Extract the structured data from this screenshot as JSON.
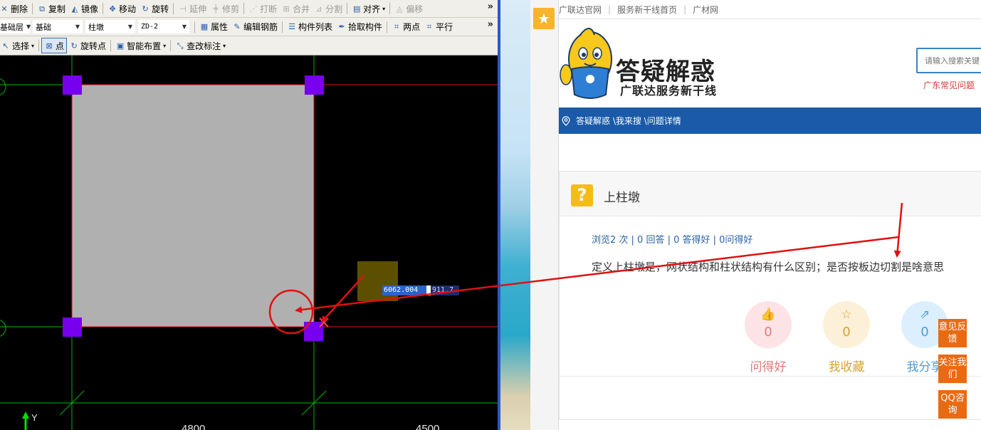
{
  "cad": {
    "toolbar1": [
      {
        "label": "删除",
        "icon": "delete-icon",
        "glyph": "✕",
        "disabled": false
      },
      {
        "label": "复制",
        "icon": "copy-icon",
        "glyph": "⧉",
        "disabled": false
      },
      {
        "label": "镜像",
        "icon": "mirror-icon",
        "glyph": "◭",
        "disabled": false
      },
      {
        "label": "移动",
        "icon": "move-icon",
        "glyph": "✥",
        "disabled": false
      },
      {
        "label": "旋转",
        "icon": "rotate-icon",
        "glyph": "↻",
        "disabled": false
      },
      {
        "label": "延伸",
        "icon": "extend-icon",
        "glyph": "⊣",
        "disabled": true
      },
      {
        "label": "修剪",
        "icon": "trim-icon",
        "glyph": "╪",
        "disabled": true
      },
      {
        "label": "打断",
        "icon": "break-icon",
        "glyph": "⋰",
        "disabled": true
      },
      {
        "label": "合并",
        "icon": "merge-icon",
        "glyph": "⊞",
        "disabled": true
      },
      {
        "label": "分割",
        "icon": "split-icon",
        "glyph": "⊿",
        "disabled": true
      },
      {
        "label": "对齐",
        "icon": "align-icon",
        "glyph": "▤",
        "disabled": false,
        "dropdown": true
      },
      {
        "label": "偏移",
        "icon": "offset-icon",
        "glyph": "◬",
        "disabled": true
      }
    ],
    "layer_combo": "基础层",
    "category_combo": "基础",
    "type_combo": "柱墩",
    "name_combo": "ZD-2",
    "toolbar2": [
      {
        "label": "属性",
        "icon": "properties-icon",
        "glyph": "▦"
      },
      {
        "label": "编辑钢筋",
        "icon": "edit-rebar-icon",
        "glyph": "✎"
      },
      {
        "label": "构件列表",
        "icon": "component-list-icon",
        "glyph": "☰"
      },
      {
        "label": "拾取构件",
        "icon": "pick-component-icon",
        "glyph": "✒"
      },
      {
        "label": "两点",
        "icon": "two-point-icon",
        "glyph": "⌗"
      },
      {
        "label": "平行",
        "icon": "parallel-icon",
        "glyph": "⌗"
      }
    ],
    "toolbar3": [
      {
        "label": "选择",
        "icon": "select-icon",
        "glyph": "↖",
        "dropdown": true,
        "pressed": false
      },
      {
        "label": "点",
        "icon": "point-icon",
        "glyph": "⊠",
        "dropdown": false,
        "pressed": true
      },
      {
        "label": "旋转点",
        "icon": "rotate-point-icon",
        "glyph": "↻",
        "dropdown": false,
        "pressed": false
      },
      {
        "label": "智能布置",
        "icon": "smart-layout-icon",
        "glyph": "▣",
        "dropdown": true,
        "pressed": false
      },
      {
        "label": "查改标注",
        "icon": "annotation-icon",
        "glyph": "⤡",
        "dropdown": true,
        "pressed": false
      }
    ],
    "more_glyph": "»",
    "coord_x": "6062.004",
    "coord_y": "911.7",
    "dim_left": "4800",
    "dim_right": "4500",
    "axis_y_label": "Y"
  },
  "web": {
    "topnav": [
      "广联达官网",
      "服务新干线首页",
      "广材网"
    ],
    "brand_title": "答疑解惑",
    "brand_sub": "广联达服务新干线",
    "search_placeholder": "请输入搜索关键",
    "hot_link": "广东常见问题",
    "breadcrumb": "答疑解惑 \\我来搜 \\问题详情",
    "question_title": "上柱墩",
    "question_mark": "?",
    "stats": "浏览2 次 | 0 回答 | 0 答得好 | 0问得好",
    "question_body": "定义上柱墩是，网状结构和柱状结构有什么区别；是否按板边切割是啥意思",
    "actions": [
      {
        "label": "问得好",
        "count": "0",
        "icon": "thumbs-up-icon",
        "glyph": "👍",
        "fg": "#e07a7a",
        "bg": "#fde3e6"
      },
      {
        "label": "我收藏",
        "count": "0",
        "icon": "star-icon",
        "glyph": "☆",
        "fg": "#d9a23a",
        "bg": "#fdf0d8"
      },
      {
        "label": "我分享",
        "count": "0",
        "icon": "share-icon",
        "glyph": "⇗",
        "fg": "#4a9ed6",
        "bg": "#dcefff"
      }
    ],
    "side_buttons": [
      "意见反馈",
      "关注我们",
      "QQ咨询"
    ],
    "fav_star": "★"
  },
  "colors": {
    "cad_background": "#000000",
    "column_fill": "#b0b0b0",
    "grip": "#7700ee",
    "grid_line": "#00b400",
    "annotation_red": "#e01010",
    "nav_blue": "#1a5aa8",
    "side_orange": "#ea6a12"
  }
}
